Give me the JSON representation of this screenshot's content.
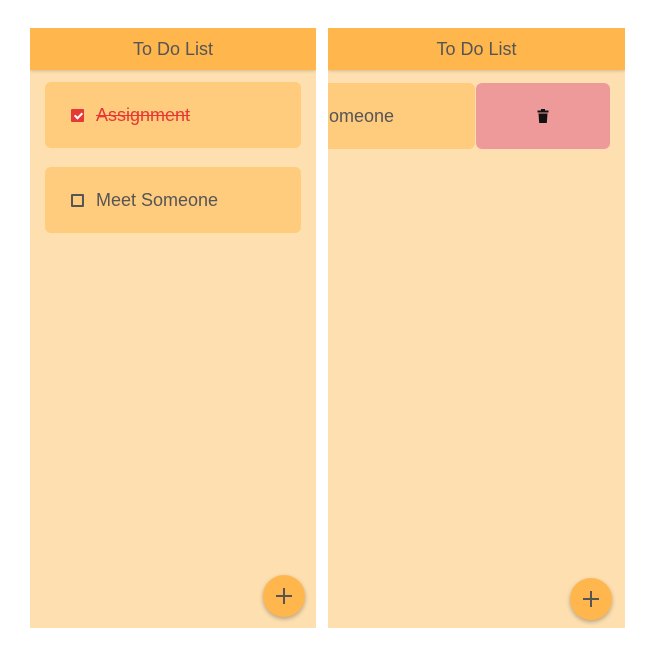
{
  "left_screen": {
    "app_title": "To Do List",
    "tasks": [
      {
        "label": "Assignment",
        "checked": true
      },
      {
        "label": "Meet Someone",
        "checked": false
      }
    ],
    "fab_icon": "plus-icon"
  },
  "right_screen": {
    "app_title": "To Do List",
    "swiped_task": {
      "visible_label": "omeone"
    },
    "delete_icon": "trash-icon",
    "fab_icon": "plus-icon"
  },
  "colors": {
    "appbar": "#ffb74d",
    "background": "#fee0b0",
    "card": "#ffcb7d",
    "done": "#e53935",
    "delete": "#ee9a9a",
    "text": "#555555"
  }
}
